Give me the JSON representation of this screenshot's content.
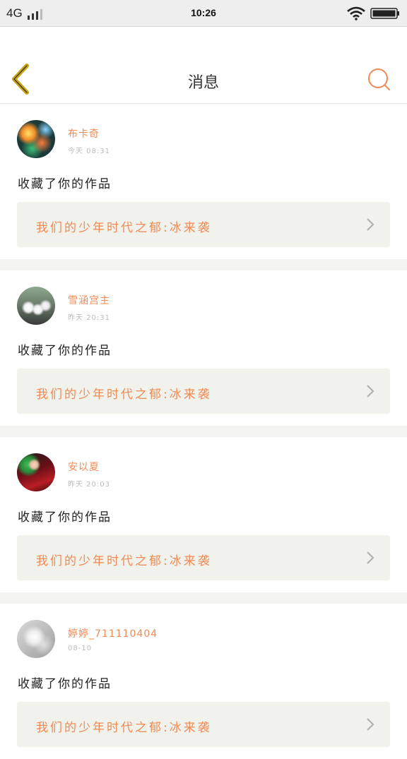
{
  "status_bar": {
    "carrier": "4G",
    "time": "10:26"
  },
  "nav": {
    "title": "消息",
    "back_icon": "back-chevron-icon",
    "search_icon": "search-icon"
  },
  "colors": {
    "accent": "#f08a55",
    "back_icon": "#c8a416",
    "card_link_bg": "#f2f2ec",
    "divider_bg": "#f3f3f1"
  },
  "messages": [
    {
      "username": "布卡奇",
      "time": "今天 08:31",
      "action": "收藏了你的作品",
      "work_title": "我们的少年时代之郁:冰来袭"
    },
    {
      "username": "雪涵宫主",
      "time": "昨天 20:31",
      "action": "收藏了你的作品",
      "work_title": "我们的少年时代之郁:冰来袭"
    },
    {
      "username": "安以夏",
      "time": "昨天 20:03",
      "action": "收藏了你的作品",
      "work_title": "我们的少年时代之郁:冰来袭"
    },
    {
      "username": "婷婷_711110404",
      "time": "08-10",
      "action": "收藏了你的作品",
      "work_title": "我们的少年时代之郁:冰来袭"
    }
  ]
}
